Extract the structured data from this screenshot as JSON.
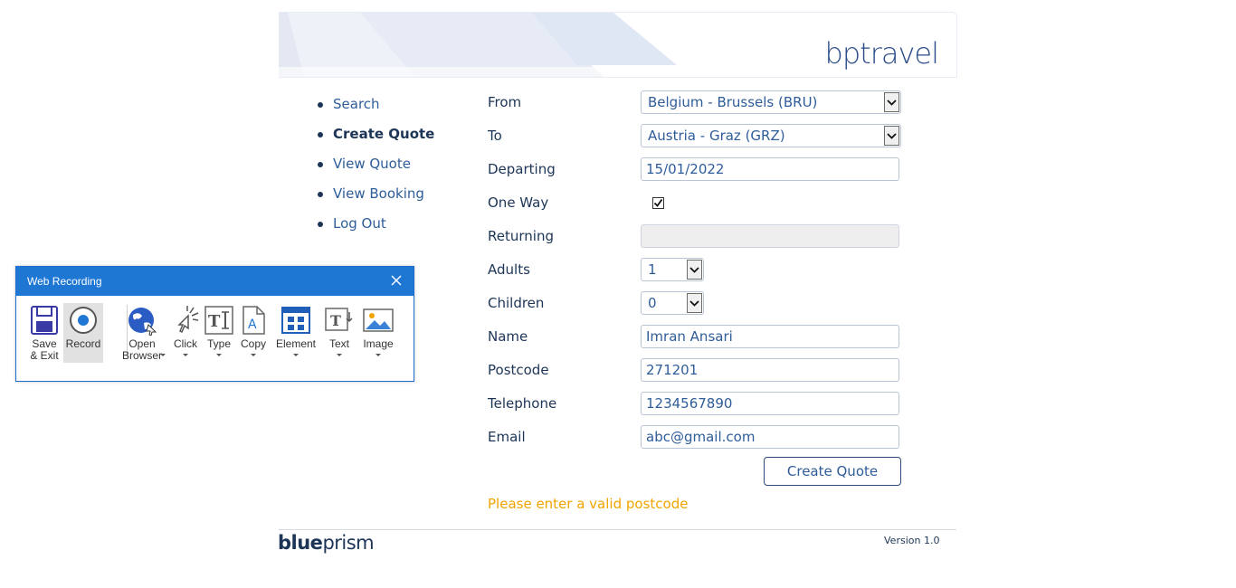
{
  "brand": "bptravel",
  "nav": {
    "items": [
      {
        "label": "Search",
        "active": false
      },
      {
        "label": "Create Quote",
        "active": true
      },
      {
        "label": "View Quote",
        "active": false
      },
      {
        "label": "View Booking",
        "active": false
      },
      {
        "label": "Log Out",
        "active": false
      }
    ]
  },
  "form": {
    "from_label": "From",
    "from_value": "Belgium - Brussels (BRU)",
    "to_label": "To",
    "to_value": "Austria - Graz (GRZ)",
    "departing_label": "Departing",
    "departing_value": "15/01/2022",
    "oneway_label": "One Way",
    "oneway_checked": true,
    "returning_label": "Returning",
    "returning_value": "",
    "adults_label": "Adults",
    "adults_value": "1",
    "children_label": "Children",
    "children_value": "0",
    "name_label": "Name",
    "name_value": "Imran Ansari",
    "postcode_label": "Postcode",
    "postcode_value": "271201",
    "telephone_label": "Telephone",
    "telephone_value": "1234567890",
    "email_label": "Email",
    "email_value": "abc@gmail.com",
    "submit_label": "Create Quote",
    "error_message": "Please enter a valid postcode"
  },
  "footer": {
    "logo_bold": "blue",
    "logo_rest": "prism",
    "version": "Version 1.0"
  },
  "recorder": {
    "title": "Web Recording",
    "tools": {
      "save_exit": "Save & Exit",
      "record": "Record",
      "open_browser": "Open Browser",
      "click": "Click",
      "type": "Type",
      "copy": "Copy",
      "element": "Element",
      "text": "Text",
      "image": "Image"
    }
  },
  "colors": {
    "accent_blue": "#1f77d4",
    "text_navy": "#1c3557",
    "link_blue": "#2e5d99",
    "error_orange": "#f0a400"
  }
}
